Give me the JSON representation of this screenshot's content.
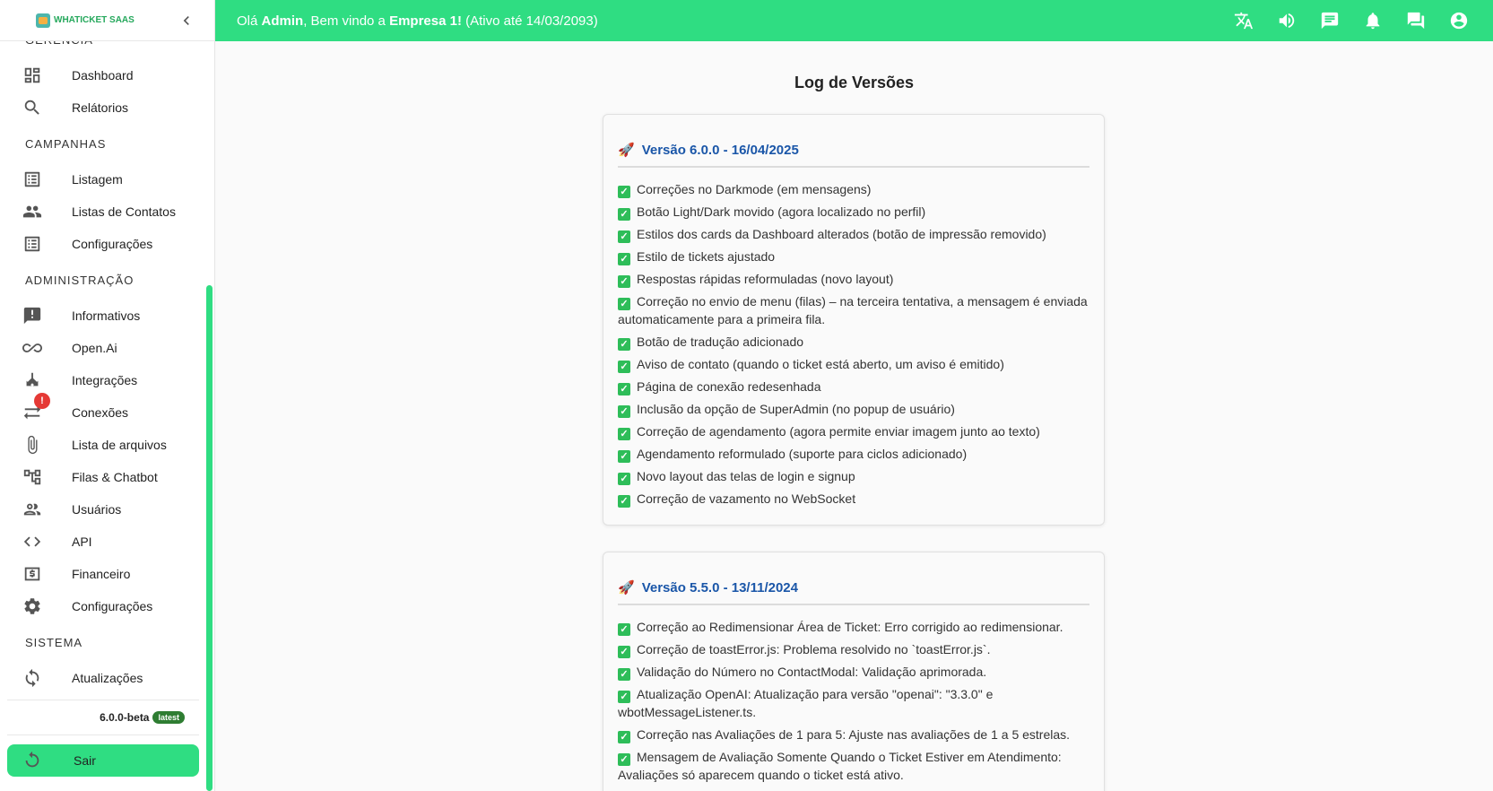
{
  "app": {
    "logo_text": "WHATICKET SAAS",
    "greeting_prefix": "Olá ",
    "user": "Admin",
    "greeting_middle": ", Bem vindo a ",
    "company": "Empresa 1!",
    "greeting_suffix": " (Ativo até 14/03/2093)"
  },
  "colors": {
    "brand_green": "#2fdd82",
    "title_blue": "#1a56a8",
    "check_green": "#2ebd59",
    "badge_red": "#e53935"
  },
  "topbar_icons": [
    "translate-icon",
    "volume-icon",
    "chat-icon",
    "bell-icon",
    "forum-icon",
    "account-icon"
  ],
  "sidebar": {
    "sections": [
      {
        "title": "GERÊNCIA",
        "items": [
          {
            "label": "Dashboard",
            "icon": "dashboard-icon"
          },
          {
            "label": "Relátorios",
            "icon": "search-icon"
          }
        ]
      },
      {
        "title": "CAMPANHAS",
        "items": [
          {
            "label": "Listagem",
            "icon": "list-icon"
          },
          {
            "label": "Listas de Contatos",
            "icon": "people-icon"
          },
          {
            "label": "Configurações",
            "icon": "list-icon"
          }
        ]
      },
      {
        "title": "ADMINISTRAÇÃO",
        "items": [
          {
            "label": "Informativos",
            "icon": "announcement-icon"
          },
          {
            "label": "Open.Ai",
            "icon": "infinity-icon"
          },
          {
            "label": "Integrações",
            "icon": "hub-icon"
          },
          {
            "label": "Conexões",
            "icon": "sync-alt-icon",
            "badge": "!"
          },
          {
            "label": "Lista de arquivos",
            "icon": "attach-icon"
          },
          {
            "label": "Filas & Chatbot",
            "icon": "tree-icon"
          },
          {
            "label": "Usuários",
            "icon": "people-outline-icon"
          },
          {
            "label": "API",
            "icon": "code-icon"
          },
          {
            "label": "Financeiro",
            "icon": "money-icon"
          },
          {
            "label": "Configurações",
            "icon": "gear-icon"
          }
        ]
      },
      {
        "title": "SISTEMA",
        "items": [
          {
            "label": "Atualizações",
            "icon": "refresh-icon"
          }
        ]
      }
    ],
    "version": "6.0.0-beta",
    "version_tag": "latest",
    "logout_label": "Sair"
  },
  "page": {
    "title": "Log de Versões",
    "versions": [
      {
        "title": "Versão 6.0.0 - 16/04/2025",
        "changes": [
          "Correções no Darkmode (em mensagens)",
          "Botão Light/Dark movido (agora localizado no perfil)",
          "Estilos dos cards da Dashboard alterados (botão de impressão removido)",
          "Estilo de tickets ajustado",
          "Respostas rápidas reformuladas (novo layout)",
          "Correção no envio de menu (filas) – na terceira tentativa, a mensagem é enviada automaticamente para a primeira fila.",
          "Botão de tradução adicionado",
          "Aviso de contato (quando o ticket está aberto, um aviso é emitido)",
          "Página de conexão redesenhada",
          "Inclusão da opção de SuperAdmin (no popup de usuário)",
          "Correção de agendamento (agora permite enviar imagem junto ao texto)",
          "Agendamento reformulado (suporte para ciclos adicionado)",
          "Novo layout das telas de login e signup",
          "Correção de vazamento no WebSocket"
        ]
      },
      {
        "title": "Versão 5.5.0 - 13/11/2024",
        "changes": [
          "Correção ao Redimensionar Área de Ticket: Erro corrigido ao redimensionar.",
          "Correção de toastError.js: Problema resolvido no `toastError.js`.",
          "Validação do Número no ContactModal: Validação aprimorada.",
          "Atualização OpenAI: Atualização para versão \"openai\": \"3.3.0\" e wbotMessageListener.ts.",
          "Correção nas Avaliações de 1 para 5: Ajuste nas avaliações de 1 a 5 estrelas.",
          "Mensagem de Avaliação Somente Quando o Ticket Estiver em Atendimento: Avaliações só aparecem quando o ticket está ativo."
        ]
      }
    ]
  }
}
